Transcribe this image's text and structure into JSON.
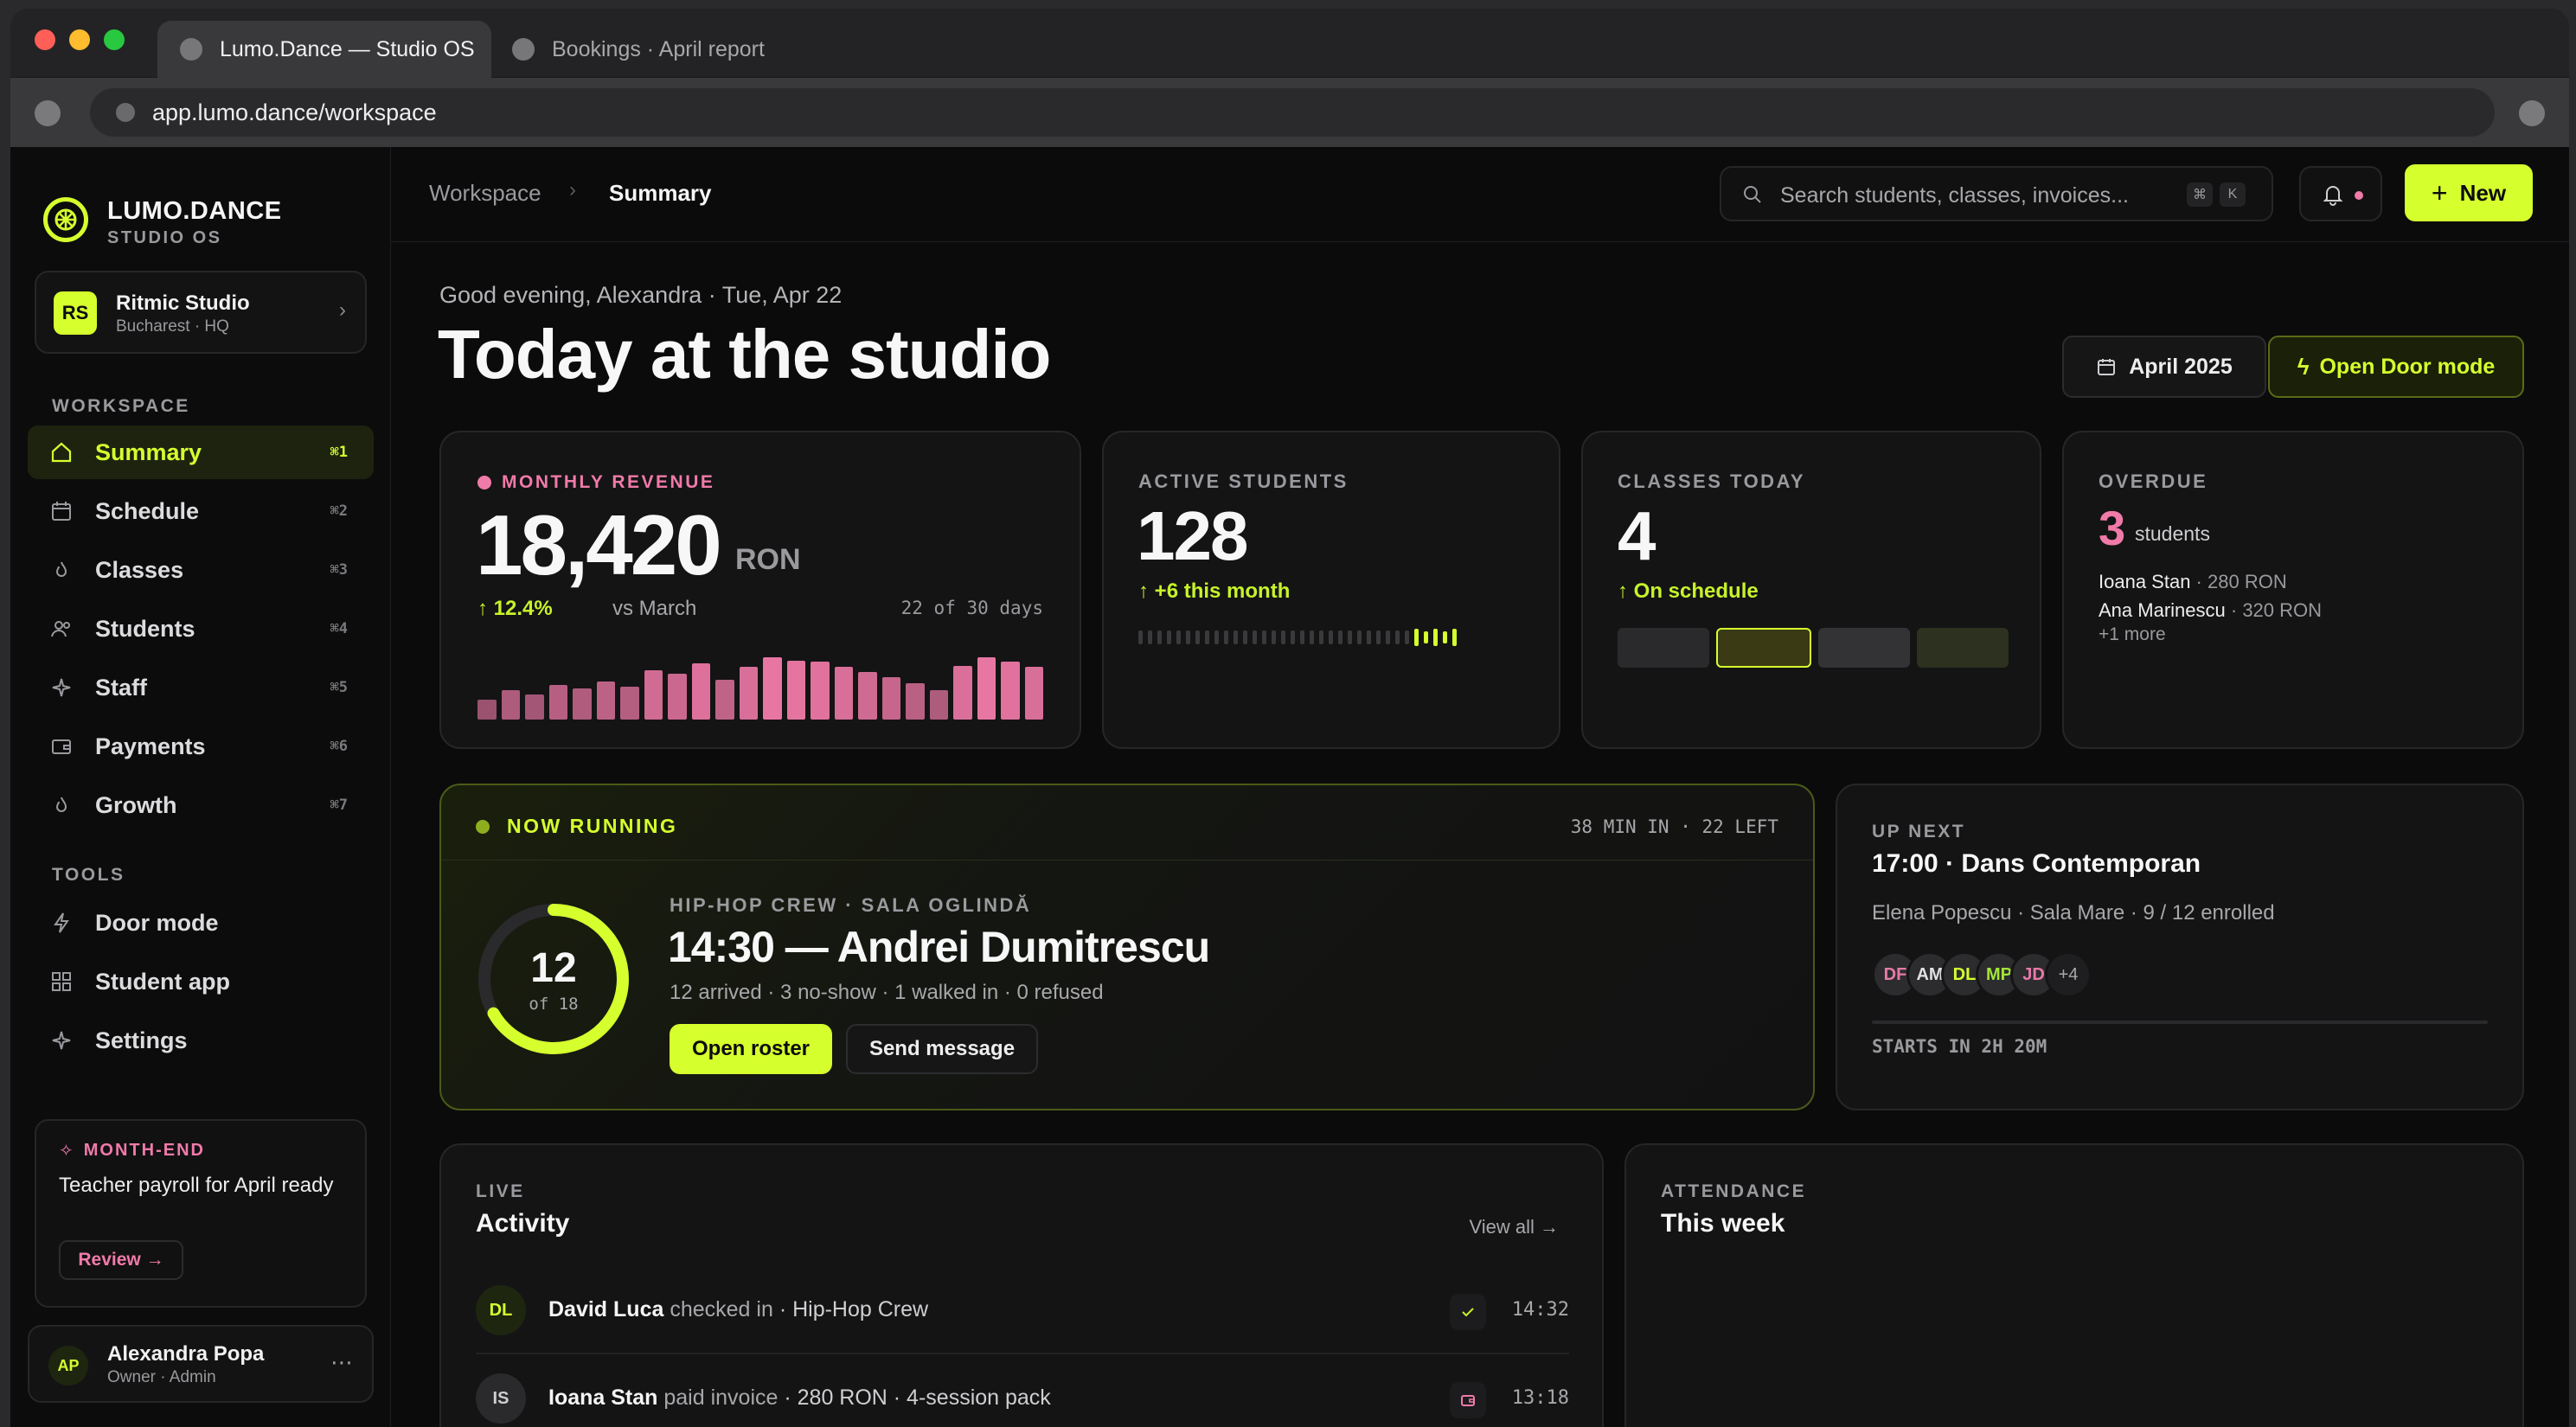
{
  "browser": {
    "tabs": [
      {
        "label": "Lumo.Dance — Studio OS"
      },
      {
        "label": "Bookings · April report"
      }
    ],
    "url": "app.lumo.dance/workspace"
  },
  "brand": {
    "name": "LUMO.DANCE",
    "subtitle": "STUDIO OS"
  },
  "studio": {
    "initials": "RS",
    "name": "Ritmic Studio",
    "location": "Bucharest · HQ"
  },
  "sidebar": {
    "workspace_label": "WORKSPACE",
    "items": [
      {
        "label": "Summary",
        "shortcut": "⌘1",
        "icon": "home-icon"
      },
      {
        "label": "Schedule",
        "shortcut": "⌘2",
        "icon": "calendar-icon"
      },
      {
        "label": "Classes",
        "shortcut": "⌘3",
        "icon": "flame-icon"
      },
      {
        "label": "Students",
        "shortcut": "⌘4",
        "icon": "users-icon"
      },
      {
        "label": "Staff",
        "shortcut": "⌘5",
        "icon": "sparkle-icon"
      },
      {
        "label": "Payments",
        "shortcut": "⌘6",
        "icon": "wallet-icon"
      },
      {
        "label": "Growth",
        "shortcut": "⌘7",
        "icon": "flame-icon"
      }
    ],
    "tools_label": "TOOLS",
    "tools": [
      {
        "label": "Door mode",
        "icon": "bolt-icon"
      },
      {
        "label": "Student app",
        "icon": "grid-icon"
      },
      {
        "label": "Settings",
        "icon": "sparkle-icon"
      }
    ],
    "promo": {
      "tag": "MONTH-END",
      "text": "Teacher payroll for April ready",
      "button": "Review →"
    },
    "user": {
      "initials": "AP",
      "name": "Alexandra Popa",
      "role": "Owner · Admin"
    }
  },
  "topbar": {
    "breadcrumb_root": "Workspace",
    "breadcrumb_current": "Summary",
    "search_placeholder": "Search students, classes, invoices...",
    "kbd1": "⌘",
    "kbd2": "K",
    "new_button": "New"
  },
  "header": {
    "greeting": "Good evening, Alexandra · Tue, Apr 22",
    "title": "Today at the studio",
    "month_button": "April 2025",
    "door_button": "Open Door mode"
  },
  "revenue": {
    "label": "MONTHLY REVENUE",
    "value": "18,420",
    "unit": "RON",
    "change": "12.4%",
    "compare": "vs March",
    "progress": "22 of 30 days",
    "bars": [
      0.3,
      0.45,
      0.38,
      0.52,
      0.48,
      0.58,
      0.5,
      0.75,
      0.7,
      0.85,
      0.6,
      0.8,
      0.95,
      0.9,
      0.88,
      0.8,
      0.72,
      0.65,
      0.55,
      0.45,
      0.82,
      0.95,
      0.88,
      0.8
    ]
  },
  "students": {
    "label": "ACTIVE STUDENTS",
    "value": "128",
    "change": "+6 this month",
    "ticks_total": 34,
    "ticks_highlight": 5
  },
  "classes": {
    "label": "CLASSES TODAY",
    "value": "4",
    "status": "On schedule",
    "slots": [
      "done",
      "current",
      "upcoming",
      "upcoming"
    ]
  },
  "overdue": {
    "label": "OVERDUE",
    "value": "3",
    "unit": "students",
    "items": [
      {
        "name": "Ioana Stan",
        "amount": "280 RON"
      },
      {
        "name": "Ana Marinescu",
        "amount": "320 RON"
      }
    ],
    "more": "+1 more"
  },
  "now_running": {
    "label": "NOW RUNNING",
    "time_info": "38 MIN IN · 22 LEFT",
    "class_info": "HIP-HOP CREW · SALA OGLINDĂ",
    "title": "14:30 — Andrei Dumitrescu",
    "details": "12 arrived · 3 no-show · 1 walked in · 0 refused",
    "count": "12",
    "count_of": "of 18",
    "fill": 0.667,
    "open_roster": "Open roster",
    "send_message": "Send message"
  },
  "up_next": {
    "label": "UP NEXT",
    "title": "17:00 · Dans Contemporan",
    "details": "Elena Popescu · Sala Mare · 9 / 12 enrolled",
    "avatars": [
      {
        "initials": "DF",
        "color": "#e879a8"
      },
      {
        "initials": "AM",
        "color": "#e0e0e2"
      },
      {
        "initials": "DL",
        "color": "#d6ff2e"
      },
      {
        "initials": "MP",
        "color": "#a3e635"
      },
      {
        "initials": "JD",
        "color": "#e879a8"
      }
    ],
    "more": "+4",
    "starts": "STARTS IN 2H 20M"
  },
  "activity": {
    "label": "LIVE",
    "title": "Activity",
    "view_all": "View all →",
    "items": [
      {
        "initials": "DL",
        "name": "David Luca",
        "action": "checked in",
        "detail": "· Hip-Hop Crew",
        "time": "14:32",
        "icon": "check-icon"
      },
      {
        "initials": "IS",
        "name": "Ioana Stan",
        "action": "paid invoice",
        "detail": "· 280 RON · 4-session pack",
        "time": "13:18",
        "icon": "wallet-icon"
      }
    ]
  },
  "attendance": {
    "label": "ATTENDANCE",
    "title": "This week"
  },
  "colors": {
    "accent": "#d6ff2e",
    "pink": "#f07aa8",
    "bg": "#0b0b0c"
  }
}
